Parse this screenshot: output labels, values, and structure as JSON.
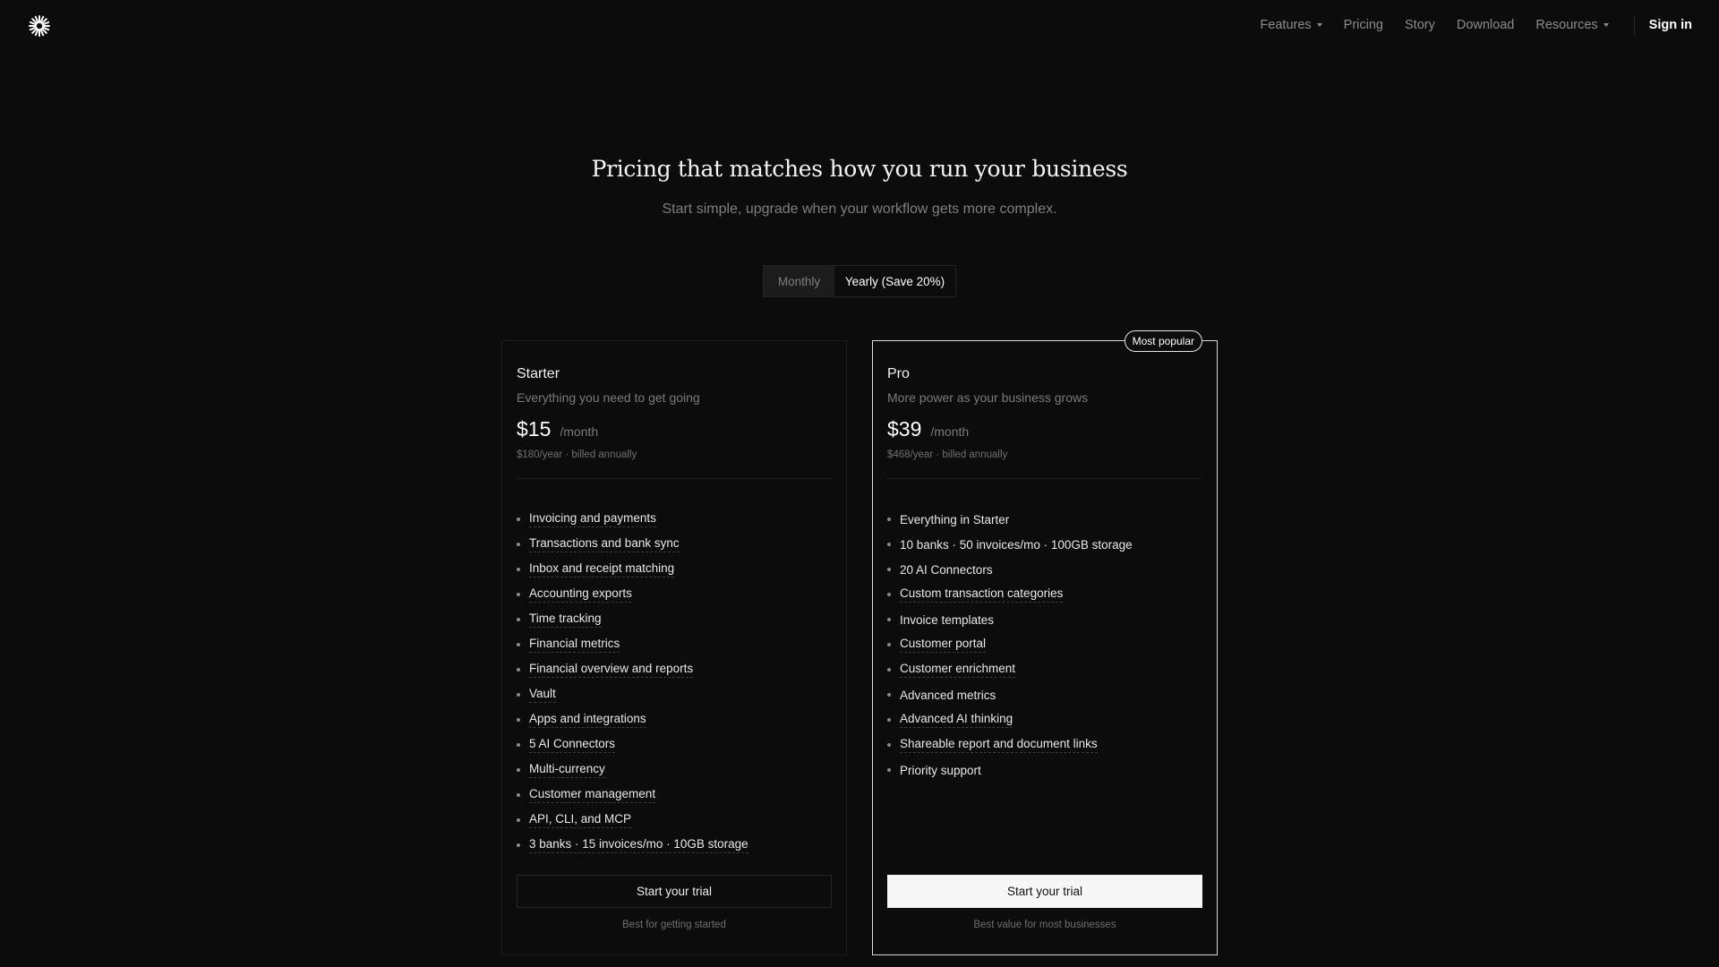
{
  "header": {
    "logo_icon": "asterisk-burst-icon",
    "nav": {
      "features": "Features",
      "pricing": "Pricing",
      "story": "Story",
      "download": "Download",
      "resources": "Resources"
    },
    "sign_in": "Sign in"
  },
  "hero": {
    "title": "Pricing that matches how you run your business",
    "subtitle": "Start simple, upgrade when your workflow gets more complex."
  },
  "billing_toggle": {
    "monthly": "Monthly",
    "yearly": "Yearly (Save 20%)",
    "selected": "yearly"
  },
  "plans": {
    "starter": {
      "name": "Starter",
      "description": "Everything you need to get going",
      "price": "$15",
      "period": "/month",
      "billed": "$180/year · billed annually",
      "features": [
        "Invoicing and payments",
        "Transactions and bank sync",
        "Inbox and receipt matching",
        "Accounting exports",
        "Time tracking",
        "Financial metrics",
        "Financial overview and reports",
        "Vault",
        "Apps and integrations",
        "5 AI Connectors",
        "Multi-currency",
        "Customer management",
        "API, CLI, and MCP",
        "3 banks · 15 invoices/mo · 10GB storage"
      ],
      "cta": "Start your trial",
      "note": "Best for getting started"
    },
    "pro": {
      "badge": "Most popular",
      "name": "Pro",
      "description": "More power as your business grows",
      "price": "$39",
      "period": "/month",
      "billed": "$468/year · billed annually",
      "features": [
        "Everything in Starter",
        "10 banks · 50 invoices/mo · 100GB storage",
        "20 AI Connectors",
        "Custom transaction categories",
        "Invoice templates",
        "Customer portal",
        "Customer enrichment",
        "Advanced metrics",
        "Advanced AI thinking",
        "Shareable report and document links",
        "Priority support"
      ],
      "cta": "Start your trial",
      "note": "Best value for most businesses"
    }
  },
  "colors": {
    "background": "#0c0c0c",
    "text": "#f2f2f2",
    "muted": "#7e7e7e",
    "pro_border": "#d8d8d8",
    "cta_primary": "#f7f7f7"
  }
}
